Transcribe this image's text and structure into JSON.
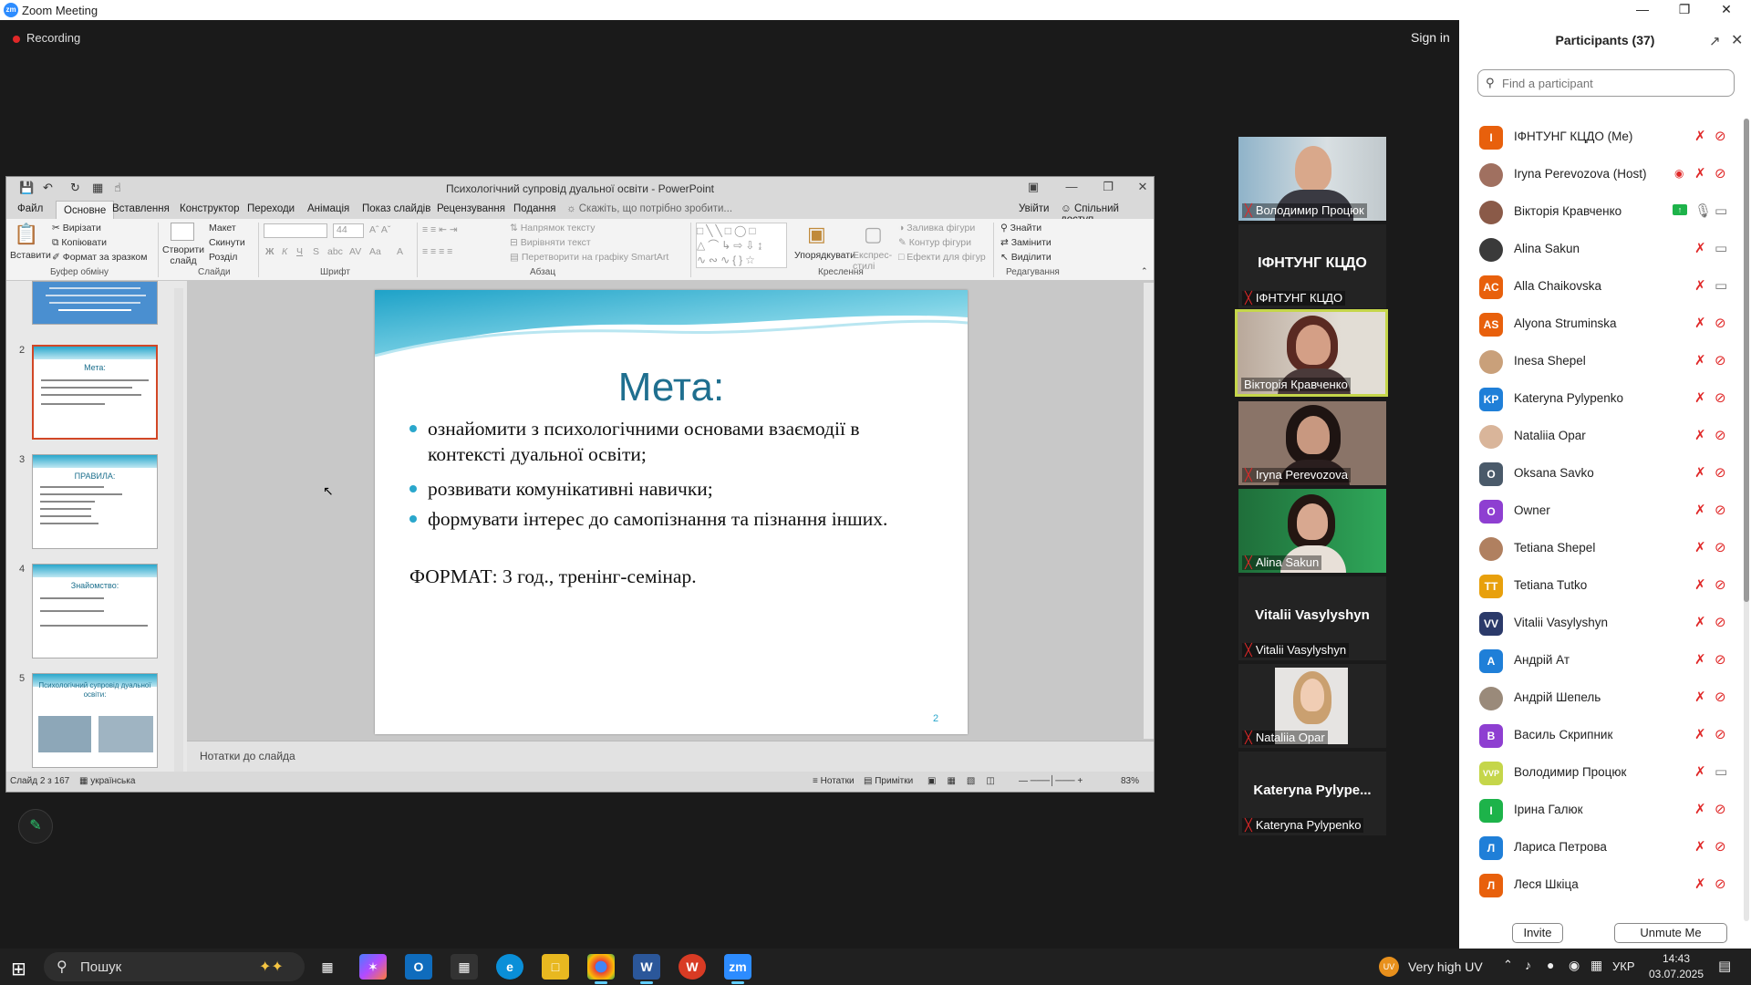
{
  "window": {
    "title": "Zoom Meeting",
    "recording": "Recording",
    "sign_in": "Sign in"
  },
  "ppt": {
    "doc_title": "Психологічний супровід дуальної освіти - PowerPoint",
    "menu": [
      "Файл",
      "Основне",
      "Вставлення",
      "Конструктор",
      "Переходи",
      "Анімація",
      "Показ слайдів",
      "Рецензування",
      "Подання"
    ],
    "active_menu": "Основне",
    "tell_me": "Скажіть, що потрібно зробити...",
    "sign_in": "Увійти",
    "share": "Спільний доступ",
    "ribbon": {
      "paste": "Вставити",
      "cut": "Вирізати",
      "copy": "Копіювати",
      "format_painter": "Формат за зразком",
      "clipboard": "Буфер обміну",
      "new_slide": "Створити слайд",
      "layout": "Макет",
      "reset": "Скинути",
      "section": "Розділ",
      "slides": "Слайди",
      "font_size": "44",
      "font": "Шрифт",
      "text_direction": "Напрямок тексту",
      "align_text": "Вирівняти текст",
      "smartart": "Перетворити на графіку SmartArt",
      "paragraph": "Абзац",
      "arrange": "Упорядкувати",
      "quick_styles": "Експрес-стилі",
      "shape_fill": "Заливка фігури",
      "shape_outline": "Контур фігури",
      "shape_effects": "Ефекти для фігур",
      "drawing": "Креслення",
      "find": "Знайти",
      "replace": "Замінити",
      "select": "Виділити",
      "editing": "Редагування"
    },
    "thumbs": [
      {
        "num": "2",
        "title": "Мета:"
      },
      {
        "num": "3",
        "title": "ПРАВИЛА:"
      },
      {
        "num": "4",
        "title": "Знайомство:"
      },
      {
        "num": "5",
        "title": "Психологічний супровід дуальної освіти:"
      }
    ],
    "slide": {
      "title": "Мета:",
      "bullets": [
        "ознайомити з психологічними основами взаємодії в контексті дуальної освіти;",
        "розвивати комунікативні навички;",
        "формувати інтерес до самопізнання та пізнання інших."
      ],
      "format": "ФОРМАТ: 3 год., тренінг-семінар.",
      "page_num": "2"
    },
    "notes": "Нотатки до слайда",
    "status": {
      "slide_counter": "Слайд 2 з 167",
      "language": "українська",
      "notes_btn": "Нотатки",
      "comments_btn": "Примітки",
      "zoom": "83%"
    }
  },
  "videos": [
    {
      "name": "Володимир Процюк",
      "big": "",
      "active": false
    },
    {
      "name": "ІФНТУНГ КЦДО",
      "big": "ІФНТУНГ КЦДО",
      "active": false
    },
    {
      "name": "Вікторія Кравченко",
      "big": "",
      "active": true
    },
    {
      "name": "Iryna Perevozova",
      "big": "",
      "active": false
    },
    {
      "name": "Alina Sakun",
      "big": "",
      "active": false
    },
    {
      "name": "Vitalii Vasylyshyn",
      "big": "Vitalii Vasylyshyn",
      "active": false
    },
    {
      "name": "Nataliia Opar",
      "big": "",
      "active": false
    },
    {
      "name": "Kateryna Pylypenko",
      "big": "Kateryna Pylype...",
      "active": false
    }
  ],
  "participants_panel": {
    "title": "Participants (37)",
    "search_placeholder": "Find a participant",
    "invite": "Invite",
    "unmute_me": "Unmute Me",
    "list": [
      {
        "initials": "I",
        "name": "ІФНТУНГ КЦДО (Me)",
        "color": "#e8600c",
        "mic": "muted",
        "cam": "off"
      },
      {
        "initials": "",
        "name": "Iryna Perevozova (Host)",
        "color": "#a07060",
        "mic": "muted",
        "cam": "off"
      },
      {
        "initials": "",
        "name": "Вікторія Кравченко",
        "color": "#8a5a48",
        "mic": "on",
        "cam": "on"
      },
      {
        "initials": "",
        "name": "Alina Sakun",
        "color": "#3a3a3a",
        "mic": "muted",
        "cam": "on"
      },
      {
        "initials": "AC",
        "name": "Alla Chaikovska",
        "color": "#e8600c",
        "mic": "muted",
        "cam": "on"
      },
      {
        "initials": "AS",
        "name": "Alyona Struminska",
        "color": "#e8600c",
        "mic": "muted",
        "cam": "off"
      },
      {
        "initials": "",
        "name": "Inesa Shepel",
        "color": "#c9a07a",
        "mic": "muted",
        "cam": "off"
      },
      {
        "initials": "KP",
        "name": "Kateryna Pylypenko",
        "color": "#1f7fd8",
        "mic": "muted",
        "cam": "off"
      },
      {
        "initials": "",
        "name": "Nataliia Opar",
        "color": "#d9b59a",
        "mic": "muted",
        "cam": "off"
      },
      {
        "initials": "O",
        "name": "Oksana Savko",
        "color": "#4a5a6a",
        "mic": "muted",
        "cam": "off"
      },
      {
        "initials": "O",
        "name": "Owner",
        "color": "#8e3fd1",
        "mic": "muted",
        "cam": "off"
      },
      {
        "initials": "",
        "name": "Tetiana Shepel",
        "color": "#b08060",
        "mic": "muted",
        "cam": "off"
      },
      {
        "initials": "TT",
        "name": "Tetiana Tutko",
        "color": "#e8a00c",
        "mic": "muted",
        "cam": "off"
      },
      {
        "initials": "VV",
        "name": "Vitalii Vasylyshyn",
        "color": "#2b3a6a",
        "mic": "muted",
        "cam": "off"
      },
      {
        "initials": "A",
        "name": "Андрій Ат",
        "color": "#1f7fd8",
        "mic": "muted",
        "cam": "off"
      },
      {
        "initials": "",
        "name": "Андрій Шепель",
        "color": "#9a8a7a",
        "mic": "muted",
        "cam": "off"
      },
      {
        "initials": "B",
        "name": "Василь Скрипник",
        "color": "#8e3fd1",
        "mic": "muted",
        "cam": "off"
      },
      {
        "initials": "VVP",
        "name": "Володимир Процюк",
        "color": "#c5d64a",
        "mic": "muted",
        "cam": "on"
      },
      {
        "initials": "I",
        "name": "Ірина Галюк",
        "color": "#1db34a",
        "mic": "muted",
        "cam": "off"
      },
      {
        "initials": "Л",
        "name": "Лариса Петрова",
        "color": "#1f7fd8",
        "mic": "muted",
        "cam": "off"
      },
      {
        "initials": "Л",
        "name": "Леся Шкіца",
        "color": "#e8600c",
        "mic": "muted",
        "cam": "off"
      }
    ]
  },
  "taskbar": {
    "search": "Пошук",
    "weather": "Very high UV",
    "lang": "УКР",
    "time": "14:43",
    "date": "03.07.2025"
  }
}
